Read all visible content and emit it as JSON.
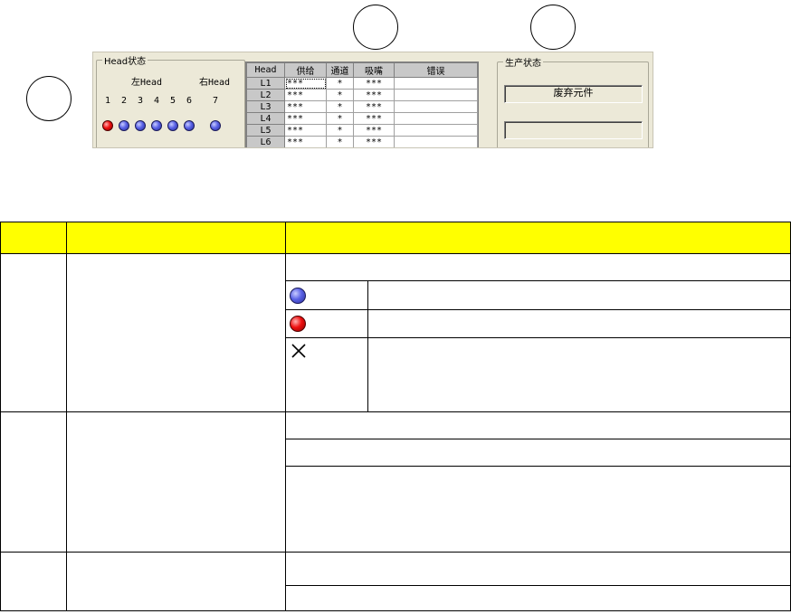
{
  "head_status": {
    "title": "Head状态",
    "left_head": "左Head",
    "right_head": "右Head",
    "numbers": [
      "1",
      "2",
      "3",
      "4",
      "5",
      "6",
      "7"
    ],
    "leds": [
      "red",
      "blue",
      "blue",
      "blue",
      "blue",
      "blue",
      "blue"
    ]
  },
  "grid": {
    "headers": [
      "Head",
      "供给",
      "通道",
      "吸嘴",
      "错误"
    ],
    "rows": [
      {
        "head": "L1",
        "feed": "***",
        "channel": "*",
        "nozzle": "***",
        "error": ""
      },
      {
        "head": "L2",
        "feed": "***",
        "channel": "*",
        "nozzle": "***",
        "error": ""
      },
      {
        "head": "L3",
        "feed": "***",
        "channel": "*",
        "nozzle": "***",
        "error": ""
      },
      {
        "head": "L4",
        "feed": "***",
        "channel": "*",
        "nozzle": "***",
        "error": ""
      },
      {
        "head": "L5",
        "feed": "***",
        "channel": "*",
        "nozzle": "***",
        "error": ""
      },
      {
        "head": "L6",
        "feed": "***",
        "channel": "*",
        "nozzle": "***",
        "error": ""
      }
    ]
  },
  "production_status": {
    "title": "生产状态",
    "field1": "废弃元件",
    "field2": ""
  },
  "colors": {
    "header_yellow": "#ffff00",
    "led_blue": "#5a62e6",
    "led_red": "#ee1010"
  }
}
